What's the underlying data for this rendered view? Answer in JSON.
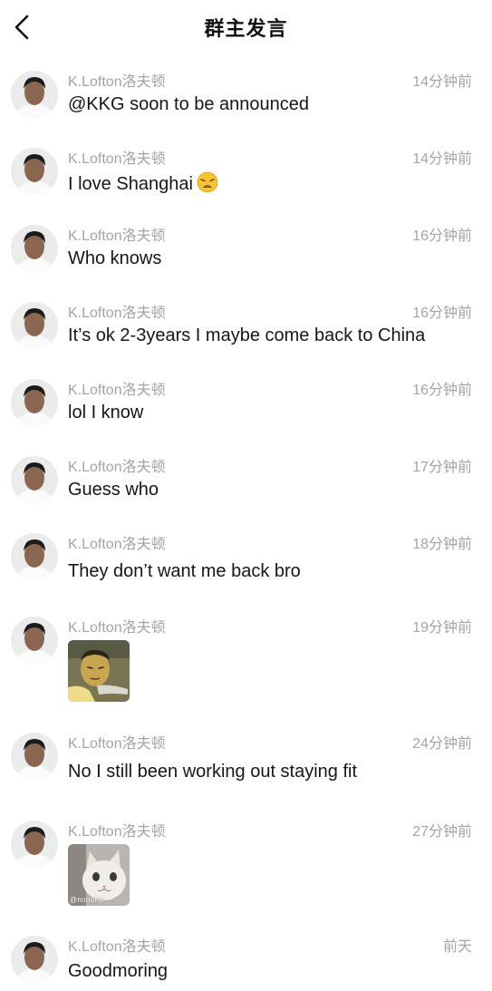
{
  "header": {
    "title": "群主发言"
  },
  "messages": [
    {
      "name": "K.Lofton洛夫顿",
      "time": "14分钟前",
      "text": "@KKG soon to be announced"
    },
    {
      "name": "K.Lofton洛夫顿",
      "time": "14分钟前",
      "text": "I love Shanghai",
      "emoji": "weary-face-emoji"
    },
    {
      "name": "K.Lofton洛夫顿",
      "time": "16分钟前",
      "text": "Who knows"
    },
    {
      "name": "K.Lofton洛夫顿",
      "time": "16分钟前",
      "text": "It’s ok 2-3years I maybe come back to China"
    },
    {
      "name": "K.Lofton洛夫顿",
      "time": "16分钟前",
      "text": "lol I know"
    },
    {
      "name": "K.Lofton洛夫顿",
      "time": "17分钟前",
      "text": "Guess who"
    },
    {
      "name": "K.Lofton洛夫顿",
      "time": "18分钟前",
      "text": "They don’t want me back bro"
    },
    {
      "name": "K.Lofton洛夫顿",
      "time": "19分钟前",
      "sticker": "man-pointing-sticker"
    },
    {
      "name": "K.Lofton洛夫顿",
      "time": "24分钟前",
      "text": "No I still been working out staying fit"
    },
    {
      "name": "K.Lofton洛夫顿",
      "time": "27分钟前",
      "sticker": "cat-sticker",
      "sticker_caption": "@nonono"
    },
    {
      "name": "K.Lofton洛夫顿",
      "time": "前天",
      "text": "Goodmoring"
    }
  ]
}
